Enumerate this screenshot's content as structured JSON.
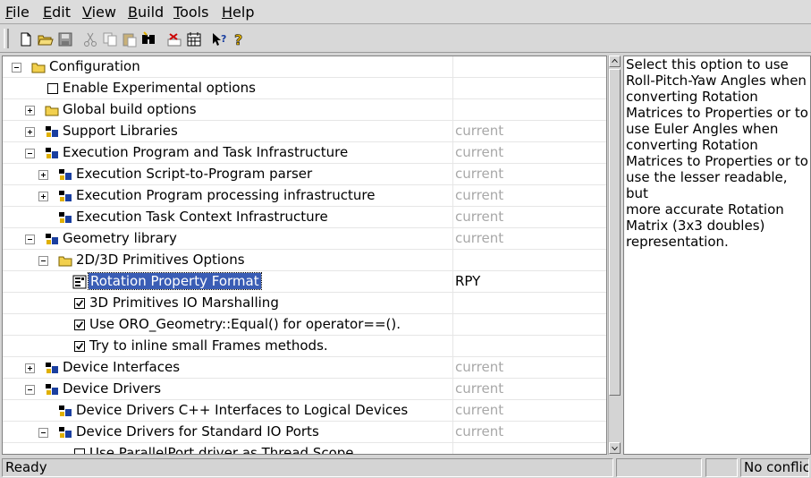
{
  "menu": {
    "items": [
      {
        "label": "File"
      },
      {
        "label": "Edit"
      },
      {
        "label": "View"
      },
      {
        "label": "Build"
      },
      {
        "label": "Tools"
      },
      {
        "label": "Help"
      }
    ]
  },
  "toolbar": {
    "icons": [
      "new-file-icon",
      "open-folder-icon",
      "save-icon",
      "cut-icon",
      "copy-icon",
      "paste-icon",
      "find-icon",
      "delete-icon",
      "calendar-icon",
      "whats-this-icon",
      "help-icon"
    ]
  },
  "tree": {
    "rows": [
      {
        "label": "Configuration",
        "value": ""
      },
      {
        "label": "Enable Experimental options",
        "value": ""
      },
      {
        "label": "Global build options",
        "value": ""
      },
      {
        "label": "Support Libraries",
        "value": "current"
      },
      {
        "label": "Execution Program and Task Infrastructure",
        "value": "current"
      },
      {
        "label": "Execution Script-to-Program parser",
        "value": "current"
      },
      {
        "label": "Execution Program processing infrastructure",
        "value": "current"
      },
      {
        "label": "Execution Task Context Infrastructure",
        "value": "current"
      },
      {
        "label": "Geometry library",
        "value": "current"
      },
      {
        "label": "2D/3D Primitives Options",
        "value": ""
      },
      {
        "label": "Rotation Property Format",
        "value": "RPY"
      },
      {
        "label": "3D Primitives IO Marshalling",
        "value": ""
      },
      {
        "label": "Use ORO_Geometry::Equal() for operator==().",
        "value": ""
      },
      {
        "label": "Try to inline small Frames methods.",
        "value": ""
      },
      {
        "label": "Device Interfaces",
        "value": "current"
      },
      {
        "label": "Device Drivers",
        "value": "current"
      },
      {
        "label": "Device Drivers C++ Interfaces to Logical Devices",
        "value": "current"
      },
      {
        "label": "Device Drivers for Standard IO Ports",
        "value": "current"
      },
      {
        "label": "Use ParallelPort driver as Thread Scope",
        "value": ""
      }
    ]
  },
  "description": {
    "lines": [
      "Select this option to use",
      "Roll-Pitch-Yaw Angles when",
      "converting Rotation",
      "Matrices to Properties or to",
      "use Euler Angles when",
      "converting Rotation",
      "Matrices to Properties or to",
      "use the lesser readable, but",
      "more accurate Rotation",
      "Matrix (3x3 doubles)",
      "representation."
    ]
  },
  "status": {
    "message": "Ready",
    "field2": "",
    "field3": "",
    "conflicts": "No conflicts"
  },
  "colors": {
    "selection": "#3a5db5",
    "muted_value": "#a8a8a8"
  }
}
